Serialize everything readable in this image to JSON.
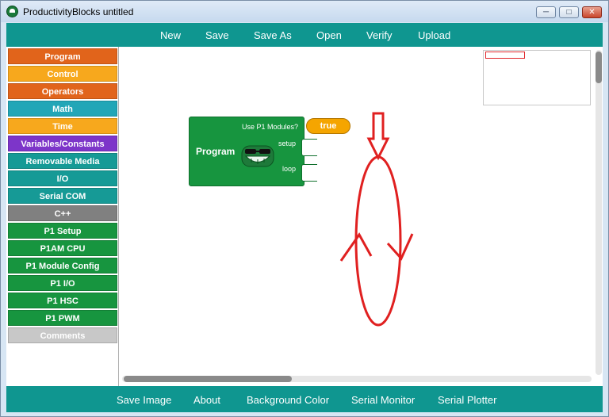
{
  "window": {
    "title": "ProductivityBlocks untitled",
    "minimize": "─",
    "maximize": "□",
    "close": "✕"
  },
  "toolbar": {
    "new": "New",
    "save": "Save",
    "save_as": "Save As",
    "open": "Open",
    "verify": "Verify",
    "upload": "Upload"
  },
  "categories": [
    {
      "label": "Program",
      "color": "#e1641b"
    },
    {
      "label": "Control",
      "color": "#f7a81d"
    },
    {
      "label": "Operators",
      "color": "#e1641b"
    },
    {
      "label": "Math",
      "color": "#22a6b7"
    },
    {
      "label": "Time",
      "color": "#f7a81d"
    },
    {
      "label": "Variables/Constants",
      "color": "#7d35c9"
    },
    {
      "label": "Removable Media",
      "color": "#169a96"
    },
    {
      "label": "I/O",
      "color": "#169a96"
    },
    {
      "label": "Serial COM",
      "color": "#169a96"
    },
    {
      "label": "C++",
      "color": "#808080"
    },
    {
      "label": "P1 Setup",
      "color": "#17953f"
    },
    {
      "label": "P1AM CPU",
      "color": "#17953f"
    },
    {
      "label": "P1 Module Config",
      "color": "#17953f"
    },
    {
      "label": "P1 I/O",
      "color": "#17953f"
    },
    {
      "label": "P1 HSC",
      "color": "#17953f"
    },
    {
      "label": "P1 PWM",
      "color": "#17953f"
    },
    {
      "label": "Comments",
      "color": "#c8c8c8"
    }
  ],
  "block": {
    "title": "Program",
    "use_modules_label": "Use P1 Modules?",
    "use_modules_value": "true",
    "setup_label": "setup",
    "loop_label": "loop"
  },
  "bottom": {
    "save_image": "Save Image",
    "about": "About",
    "background_color": "Background Color",
    "serial_monitor": "Serial Monitor",
    "serial_plotter": "Serial Plotter"
  }
}
